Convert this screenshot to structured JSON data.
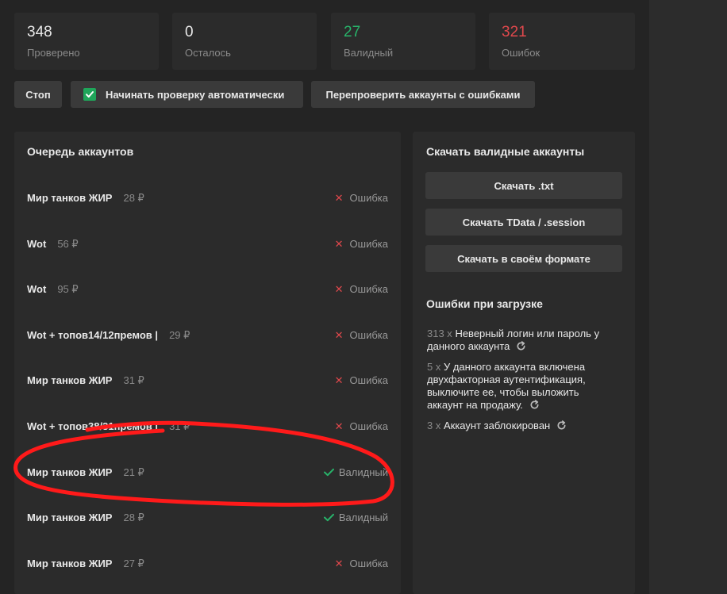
{
  "stats": [
    {
      "value": "348",
      "label": "Проверено",
      "color": "#e8e8e8"
    },
    {
      "value": "0",
      "label": "Осталось",
      "color": "#e8e8e8"
    },
    {
      "value": "27",
      "label": "Валидный",
      "color": "#28b36a"
    },
    {
      "value": "321",
      "label": "Ошибок",
      "color": "#e0484c"
    }
  ],
  "toolbar": {
    "stop_label": "Стоп",
    "auto_start_label": "Начинать проверку автоматически",
    "auto_start_checked": true,
    "recheck_label": "Перепроверить аккаунты с ошибками"
  },
  "queue": {
    "title": "Очередь аккаунтов",
    "rows": [
      {
        "name": "Мир танков ЖИР",
        "price": "28 ₽",
        "status": "Ошибка",
        "status_type": "error"
      },
      {
        "name": "Wot",
        "price": "56 ₽",
        "status": "Ошибка",
        "status_type": "error"
      },
      {
        "name": "Wot",
        "price": "95 ₽",
        "status": "Ошибка",
        "status_type": "error"
      },
      {
        "name": "Wot + топов14/12премов |",
        "price": "29 ₽",
        "status": "Ошибка",
        "status_type": "error"
      },
      {
        "name": "Мир танков ЖИР",
        "price": "31 ₽",
        "status": "Ошибка",
        "status_type": "error"
      },
      {
        "name": "Wot + топов38/31премов |",
        "price": "31 ₽",
        "status": "Ошибка",
        "status_type": "error"
      },
      {
        "name": "Мир танков ЖИР",
        "price": "21 ₽",
        "status": "Валидный",
        "status_type": "valid"
      },
      {
        "name": "Мир танков ЖИР",
        "price": "28 ₽",
        "status": "Валидный",
        "status_type": "valid"
      },
      {
        "name": "Мир танков ЖИР",
        "price": "27 ₽",
        "status": "Ошибка",
        "status_type": "error"
      }
    ]
  },
  "download": {
    "title": "Скачать валидные аккаунты",
    "txt_label": "Скачать .txt",
    "tdata_label": "Скачать TData / .session",
    "custom_label": "Скачать в своём формате"
  },
  "errors": {
    "title": "Ошибки при загрузке",
    "items": [
      {
        "count": "313 x",
        "text": "Неверный логин или пароль у данного аккаунта"
      },
      {
        "count": "5 x",
        "text": "У данного аккаунта включена двухфакторная аутентификация, выключите ее, чтобы выложить аккаунт на продажу."
      },
      {
        "count": "3 x",
        "text": "Аккаунт заблокирован"
      }
    ]
  },
  "colors": {
    "valid": "#28b36a",
    "error": "#e0484c",
    "annotation": "#ff1a1a"
  }
}
